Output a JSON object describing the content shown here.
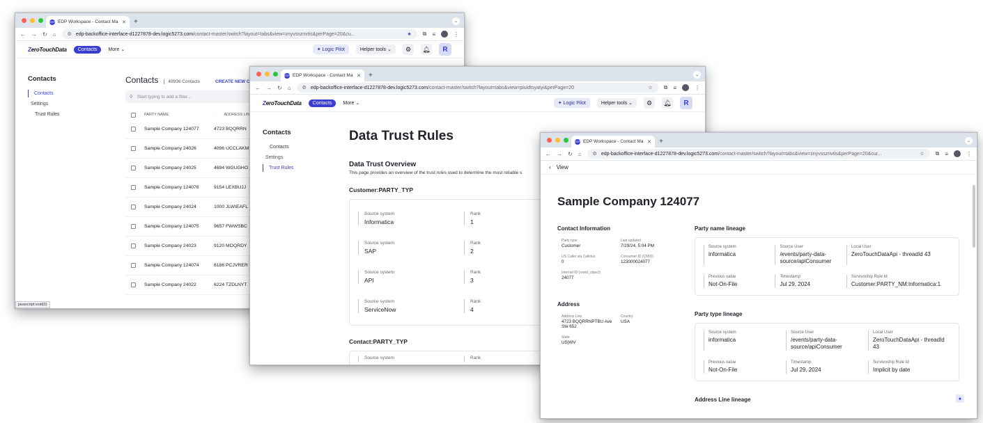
{
  "browser": {
    "tab_title": "EDP Workspace - Contact Ma",
    "favicon_text": "EDP",
    "url_host": "edp-backoffice-interface-d1227878-dev.logic5273.com",
    "url_w1_path": "/contact-master/switch?layout=tabs&view=znyvssznvtis&perPage=20&cu...",
    "url_w2_path": "/contact-master/switch?layout=tabs&view=piuidtsyatyi&perPage=20",
    "url_w3_path": "/contact-master/switch?layout=tabs&view=znyvssznvtis&perPage=20&cur..."
  },
  "app": {
    "logo_mark": "Z",
    "logo_text": "eroTouchData",
    "nav_pill": "Contacts",
    "more": "More",
    "logic_pilot": "Logic Pilot",
    "helper_tools": "Helper tools",
    "avatar_letter": "R"
  },
  "sidebar": {
    "title": "Contacts",
    "items": [
      {
        "label": "Contacts"
      },
      {
        "label": "Settings"
      },
      {
        "label": "Trust Rules"
      }
    ]
  },
  "contacts": {
    "title": "Contacts",
    "count": "49936 Contacts",
    "create": "CREATE NEW C",
    "filter_placeholder": "Start typing to add a filter...",
    "columns": [
      "PARTY NAME",
      "ADDRESS LINE"
    ],
    "rows": [
      {
        "name": "Sample Company 124077",
        "addr": "4723 BQQRRN"
      },
      {
        "name": "Sample Company 24026",
        "addr": "4096 UCCLAKM"
      },
      {
        "name": "Sample Company 24025",
        "addr": "4694 WGUGHO"
      },
      {
        "name": "Sample Company 124076",
        "addr": "9154 LEXBUJJ"
      },
      {
        "name": "Sample Company 24024",
        "addr": "1000 JLWIEAFL"
      },
      {
        "name": "Sample Company 124075",
        "addr": "9657 FWWSBC"
      },
      {
        "name": "Sample Company 24023",
        "addr": "9120 MOQRDY"
      },
      {
        "name": "Sample Company 124074",
        "addr": "6186 PCJVRER"
      },
      {
        "name": "Sample Company 24022",
        "addr": "6224 TZDLNYT"
      }
    ],
    "status_hint": "javascript:void(0)"
  },
  "trust": {
    "title": "Data Trust Rules",
    "overview_title": "Data Trust Overview",
    "overview_desc": "This page provides an overview of the trust rules used to determine the most reliable s",
    "section1": "Customer:PARTY_TYP",
    "section2": "Contact:PARTY_TYP",
    "label_source": "Source system",
    "label_rank": "Rank",
    "rules": [
      {
        "source": "Informatica",
        "rank": "1"
      },
      {
        "source": "SAP",
        "rank": "2"
      },
      {
        "source": "API",
        "rank": "3"
      },
      {
        "source": "ServiceNow",
        "rank": "4"
      }
    ]
  },
  "detail": {
    "back": "View",
    "title": "Sample Company 124077",
    "contact_info_title": "Contact Information",
    "contact_info": [
      {
        "label": "Party type",
        "value": "Customer"
      },
      {
        "label": "Last updated",
        "value": "7/29/24, 5:04 PM"
      },
      {
        "label": "US Caller via Callidus",
        "value": "0"
      },
      {
        "label": "Consumer ID (CMID)",
        "value": "123000024077"
      },
      {
        "label": "Internal ID (rowid_object)",
        "value": "24077"
      }
    ],
    "address_title": "Address",
    "address": [
      {
        "label": "Address Line",
        "value": "4723 BQQRRNPTBU Ave Ste 652"
      },
      {
        "label": "Country",
        "value": "USA"
      },
      {
        "label": "State",
        "value": "US|WV"
      }
    ],
    "lineage_labels": {
      "source_system": "Source system",
      "source_user": "Source User",
      "local_user": "Local User",
      "previous_value": "Previous value",
      "timestamp": "Timestamp",
      "rule_id": "Survivoship Rule Id"
    },
    "lineage": [
      {
        "title": "Party name lineage",
        "source_system": "informatica",
        "source_user": "/events/party-data-source/apiConsumer",
        "local_user": "ZeroTouchDataApi - threadId 43",
        "previous_value": "Not-On-File",
        "timestamp": "Jul 29, 2024",
        "rule_id": "Customer:PARTY_NM:Informatica:1"
      },
      {
        "title": "Party type lineage",
        "source_system": "informatica",
        "source_user": "/events/party-data-source/apiConsumer",
        "local_user": "ZeroTouchDataApi - threadId 43",
        "previous_value": "Not-On-File",
        "timestamp": "Jul 29, 2024",
        "rule_id": "Implicit by date"
      }
    ],
    "address_lineage_title": "Address Line lineage"
  }
}
